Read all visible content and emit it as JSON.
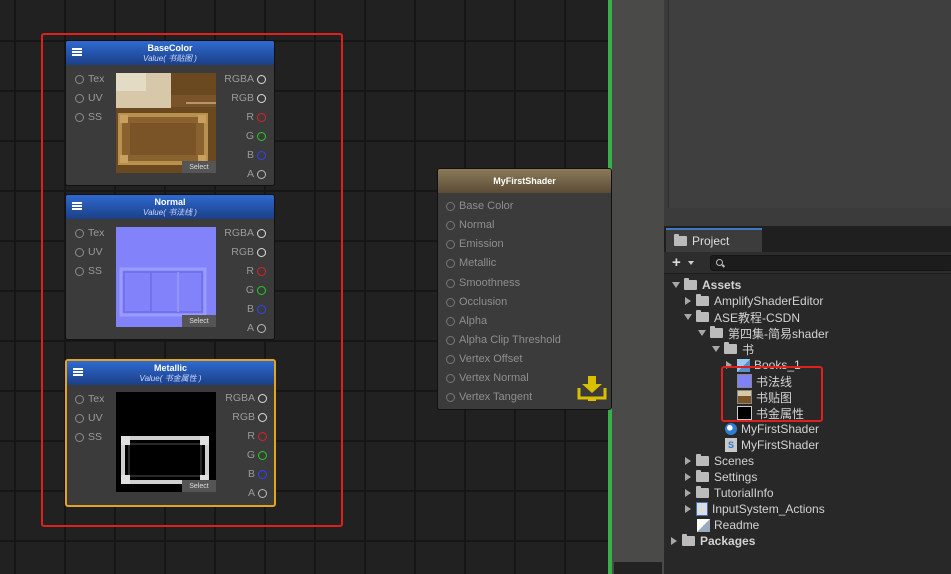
{
  "canvas": {
    "nodes": [
      {
        "title": "BaseColor",
        "subtitle": "Value( 书贴图 )",
        "inputs": [
          "Tex",
          "UV",
          "SS"
        ],
        "outputs": [
          "RGBA",
          "RGB",
          "R",
          "G",
          "B",
          "A"
        ],
        "select_label": "Select",
        "preview": "wood texture"
      },
      {
        "title": "Normal",
        "subtitle": "Value( 书法线 )",
        "inputs": [
          "Tex",
          "UV",
          "SS"
        ],
        "outputs": [
          "RGBA",
          "RGB",
          "R",
          "G",
          "B",
          "A"
        ],
        "select_label": "Select",
        "preview": "normal map"
      },
      {
        "title": "Metallic",
        "subtitle": "Value( 书金属性 )",
        "inputs": [
          "Tex",
          "UV",
          "SS"
        ],
        "outputs": [
          "RGBA",
          "RGB",
          "R",
          "G",
          "B",
          "A"
        ],
        "select_label": "Select",
        "preview": "metallic mask"
      }
    ],
    "master_node": {
      "title": "MyFirstShader",
      "ports": [
        "Base Color",
        "Normal",
        "Emission",
        "Metallic",
        "Smoothness",
        "Occlusion",
        "Alpha",
        "Alpha Clip Threshold",
        "Vertex Offset",
        "Vertex Normal",
        "Vertex Tangent"
      ]
    },
    "icons": {
      "menu": "hamburger-menu-icon",
      "save": "save-download-icon"
    }
  },
  "project": {
    "tab_label": "Project",
    "add_label": "+",
    "search": {
      "placeholder": ""
    },
    "tree": {
      "assets": "Assets",
      "amplify": "AmplifyShaderEditor",
      "ase": "ASE教程-CSDN",
      "episode4": "第四集-简易shader",
      "book_folder": "书",
      "books_model": "Books_1",
      "normal_tex": "书法线",
      "base_tex": "书贴图",
      "metal_tex": "书金属性",
      "shader_material": "MyFirstShader",
      "shader_file": "MyFirstShader",
      "scenes": "Scenes",
      "settings": "Settings",
      "tutorial": "TutorialInfo",
      "input_actions": "InputSystem_Actions",
      "readme": "Readme",
      "packages": "Packages"
    }
  },
  "colors": {
    "highlight_red": "#e0201c",
    "selection_orange": "#e6a31c",
    "node_header_blue": "#2f6ad0",
    "master_header_brown": "#8a7a5a",
    "separator_green": "#38b04a"
  }
}
